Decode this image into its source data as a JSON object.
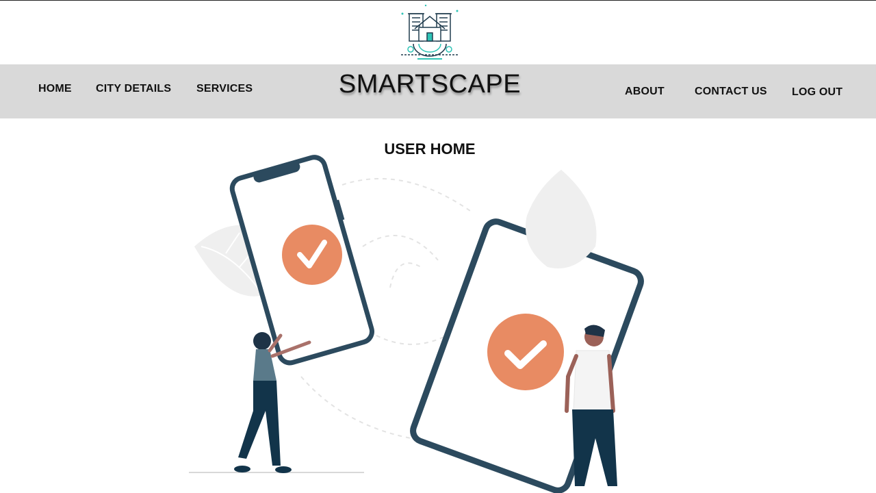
{
  "brand": {
    "name": "SMARTSCAPE",
    "logo_icon": "smart-city-house-gear-icon",
    "logo_colors": [
      "#1f3b4d",
      "#2ec4b6"
    ]
  },
  "nav": {
    "home": "HOME",
    "city_details": "CITY DETAILS",
    "services": "SERVICES",
    "about": "ABOUT",
    "contact_us": "CONTACT US",
    "log_out": "LOG OUT"
  },
  "main": {
    "title": "USER HOME",
    "illustration": "two-phones-with-checkmarks-illustration"
  },
  "colors": {
    "navbar_bg": "#d9d9d9",
    "device_frame": "#2c4a5e",
    "check_badge": "#e88b63",
    "leaf": "#efefef"
  }
}
